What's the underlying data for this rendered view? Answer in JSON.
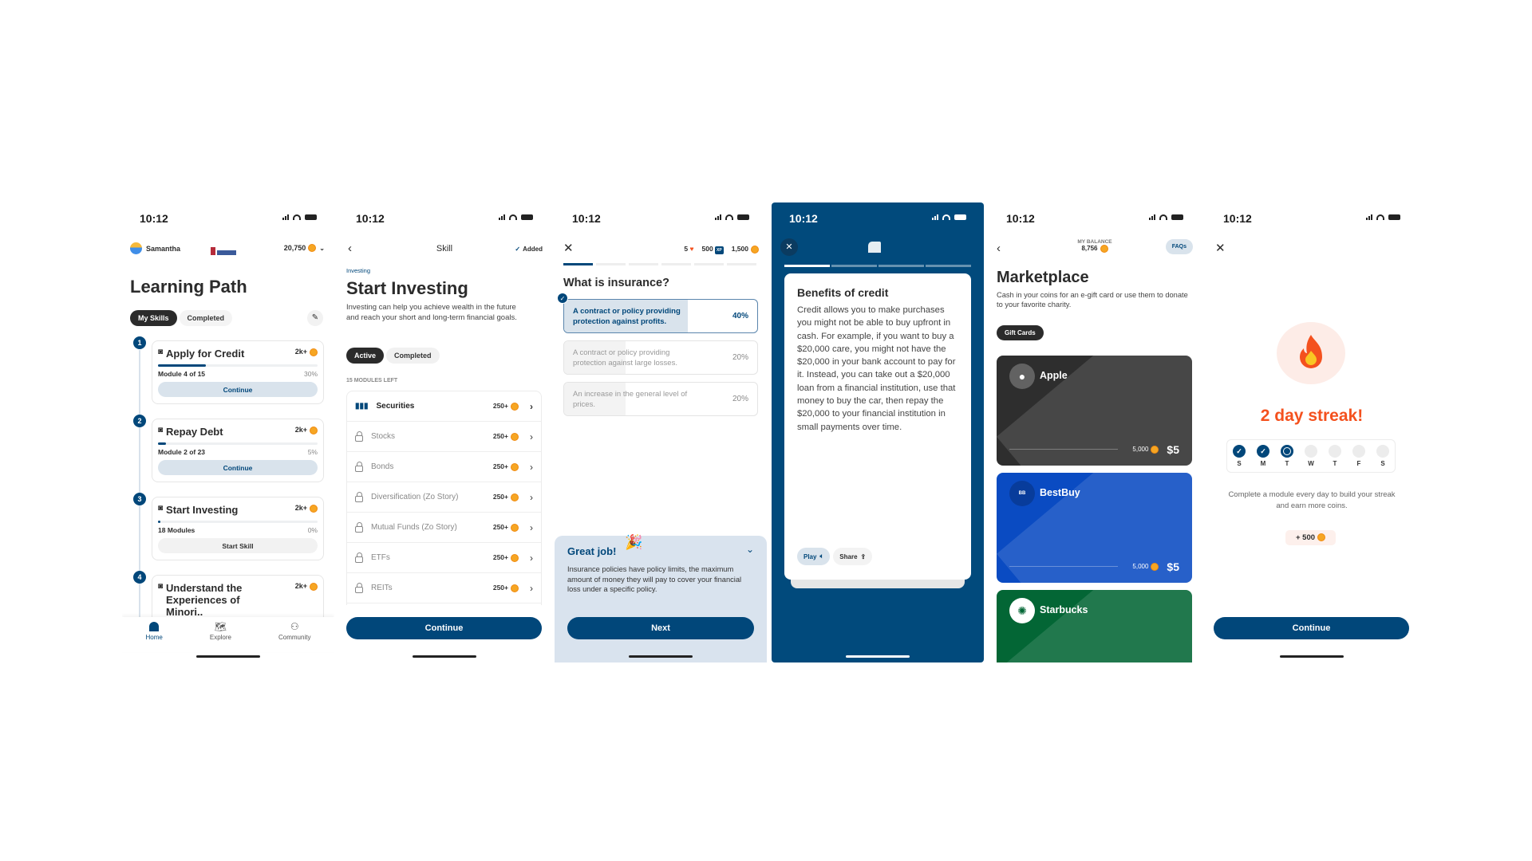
{
  "status": {
    "time": "10:12"
  },
  "colors": {
    "navy": "#01477a",
    "coin": "#f6a623",
    "streak": "#f4511e",
    "pale_blue": "#d9e3ec"
  },
  "home": {
    "user": "Samantha",
    "logo": "Century",
    "coins": "20,750",
    "title": "Learning Path",
    "tabs": [
      "My Skills",
      "Completed"
    ],
    "skills": [
      {
        "num": "1",
        "title": "Apply for Credit",
        "reward": "2k+",
        "meta": "Module 4 of 15",
        "pct": "30%",
        "progress": 30,
        "button": "Continue"
      },
      {
        "num": "2",
        "title": "Repay Debt",
        "reward": "2k+",
        "meta": "Module 2 of 23",
        "pct": "5%",
        "progress": 5,
        "button": "Continue"
      },
      {
        "num": "3",
        "title": "Start Investing",
        "reward": "2k+",
        "meta": "18 Modules",
        "pct": "0%",
        "progress": 0,
        "button": "Start Skill"
      },
      {
        "num": "4",
        "title": "Understand the Experiences of Minori..",
        "reward": "2k+",
        "progress": 0
      }
    ],
    "nav": [
      "Home",
      "Explore",
      "Community"
    ]
  },
  "skill": {
    "header": "Skill",
    "added": "Added",
    "category": "Investing",
    "title": "Start Investing",
    "description": "Investing can help you achieve wealth in the future and reach your short and long-term financial goals.",
    "tabs": [
      "Active",
      "Completed"
    ],
    "modules_left": "15 MODULES LEFT",
    "modules": [
      {
        "name": "Securities",
        "reward": "250+",
        "locked": false
      },
      {
        "name": "Stocks",
        "reward": "250+",
        "locked": true
      },
      {
        "name": "Bonds",
        "reward": "250+",
        "locked": true
      },
      {
        "name": "Diversification (Zo Story)",
        "reward": "250+",
        "locked": true
      },
      {
        "name": "Mutual Funds (Zo Story)",
        "reward": "250+",
        "locked": true
      },
      {
        "name": "ETFs",
        "reward": "250+",
        "locked": true
      },
      {
        "name": "REITs",
        "reward": "250+",
        "locked": true
      }
    ],
    "continue": "Continue"
  },
  "quiz": {
    "hearts": "5",
    "xp": "500",
    "xp_badge": "XP",
    "coins": "1,500",
    "question": "What is insurance?",
    "progress_segments": 6,
    "progress_done": 1,
    "options": [
      {
        "text": "A contract or policy providing protection against profits.",
        "pct": "40%",
        "value": 40,
        "selected": true
      },
      {
        "text": "A contract or policy providing protection against large losses.",
        "pct": "20%",
        "value": 20,
        "selected": false
      },
      {
        "text": "An increase in the general level of prices.",
        "pct": "20%",
        "value": 20,
        "selected": false
      }
    ],
    "feedback_title": "Great job!",
    "feedback_text": "Insurance policies have policy limits, the maximum amount of money they will pay to cover your financial loss under a specific policy.",
    "next": "Next"
  },
  "story": {
    "progress_segments": 4,
    "progress_done": 1,
    "title": "Benefits of credit",
    "body": "Credit allows you to make purchases you might not be able to buy upfront in cash. For example, if you want to buy a $20,000 care, you might not have the $20,000 in your bank account to pay for it. Instead, you can take out a $20,000 loan from a financial institution, use that money to buy the car, then repay the $20,000 to your financial institution in small payments over time.",
    "play": "Play",
    "share": "Share"
  },
  "market": {
    "balance_label": "MY BALANCE",
    "balance": "8,756",
    "faqs": "FAQs",
    "title": "Marketplace",
    "description": "Cash in your coins for an e-gift card or use them to donate to your favorite charity.",
    "filter": "Gift Cards",
    "cards": [
      {
        "name": "Apple",
        "coins": "5,000",
        "price": "$5",
        "color": "#2e2e2e"
      },
      {
        "name": "BestBuy",
        "coins": "5,000",
        "price": "$5",
        "color": "#0a4bc2"
      },
      {
        "name": "Starbucks",
        "color": "#036635"
      }
    ]
  },
  "streak": {
    "title": "2 day streak!",
    "days": [
      {
        "l": "S",
        "s": "done"
      },
      {
        "l": "M",
        "s": "done"
      },
      {
        "l": "T",
        "s": "cur"
      },
      {
        "l": "W",
        "s": ""
      },
      {
        "l": "T",
        "s": ""
      },
      {
        "l": "F",
        "s": ""
      },
      {
        "l": "S",
        "s": ""
      }
    ],
    "text": "Complete a module every day to build your streak and earn more coins.",
    "reward": "+ 500",
    "continue": "Continue"
  }
}
